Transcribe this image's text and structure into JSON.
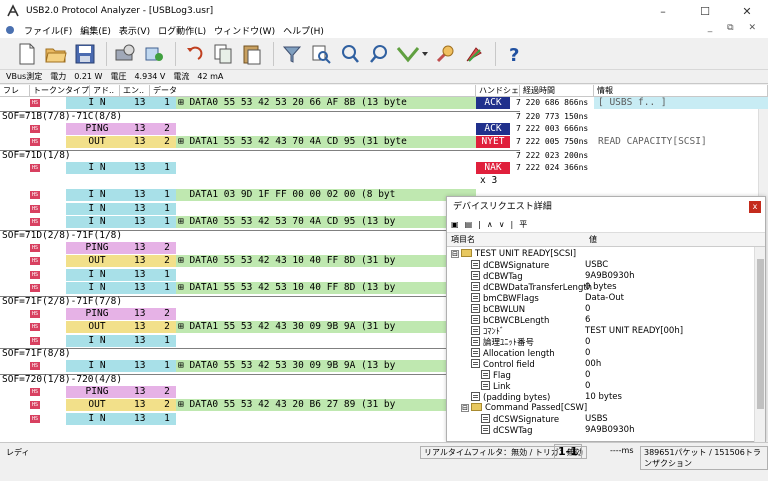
{
  "window": {
    "title": "USB2.0 Protocol Analyzer - [USBLog3.usr]",
    "minimize": "–",
    "maximize": "☐",
    "close": "✕"
  },
  "menu": {
    "items": [
      "ファイル(F)",
      "編集(E)",
      "表示(V)",
      "ログ動作(L)",
      "ウィンドウ(W)",
      "ヘルプ(H)"
    ],
    "mdi": "_ ⧉ ✕"
  },
  "vbus": {
    "label": "VBus測定",
    "power_label": "電力",
    "power": "0.21 W",
    "voltage_label": "電圧",
    "voltage": "4.934 V",
    "current_label": "電流",
    "current": "42 mA"
  },
  "columns": {
    "frame": "フレー..",
    "token": "トークンタイプ",
    "addr": "アド..",
    "ep": "エン..",
    "data": "データ",
    "handshake": "ハンドシェイ..",
    "elapsed": "経過時間",
    "info": "情報"
  },
  "trace": [
    {
      "kind": "pkt",
      "token": "I N",
      "addr": "13",
      "ep": "1",
      "expand": true,
      "data": "DATA0 55 53 42 53 20 66 AF 8B (13 byte",
      "hs": "ACK",
      "time": "7 220 686 866ns",
      "info": "[ USBS f.. ]"
    },
    {
      "kind": "sof",
      "text": "SOF=71B(7/8)-71C(8/8)",
      "time": "7 220 773 150ns"
    },
    {
      "kind": "pkt",
      "token": "PING",
      "addr": "13",
      "ep": "2",
      "expand": false,
      "data": "",
      "hs": "ACK",
      "time": "7 222 003 666ns",
      "info": ""
    },
    {
      "kind": "pkt",
      "token": "OUT",
      "addr": "13",
      "ep": "2",
      "expand": true,
      "data": "DATA1 55 53 42 43 70 4A CD 95 (31 byte",
      "hs": "NYET",
      "time": "7 222 005 750ns",
      "info": "READ CAPACITY[SCSI]"
    },
    {
      "kind": "sof",
      "text": "SOF=71D(1/8)",
      "time": "7 222 023 200ns"
    },
    {
      "kind": "pkt",
      "token": "I N",
      "addr": "13",
      "ep": "1",
      "expand": false,
      "data": "",
      "hs": "NAK",
      "time": "7 222 024 366ns",
      "info": ""
    },
    {
      "kind": "count",
      "text": "x 3"
    },
    {
      "kind": "pkt",
      "token": "I N",
      "addr": "13",
      "ep": "1",
      "expand": false,
      "data": "DATA1 03 9D 1F FF 00 00 02 00 (8 byt",
      "hs": "",
      "time": "",
      "info": ""
    },
    {
      "kind": "pkt",
      "token": "I N",
      "addr": "13",
      "ep": "1",
      "expand": false,
      "data": "",
      "hs": "",
      "time": "",
      "info": ""
    },
    {
      "kind": "pkt",
      "token": "I N",
      "addr": "13",
      "ep": "1",
      "expand": true,
      "data": "DATA0 55 53 42 53 70 4A CD 95 (13 by",
      "hs": "",
      "time": "",
      "info": ""
    },
    {
      "kind": "sof",
      "text": "SOF=71D(2/8)-71F(1/8)",
      "time": ""
    },
    {
      "kind": "pkt",
      "token": "PING",
      "addr": "13",
      "ep": "2",
      "expand": false,
      "data": "",
      "hs": "",
      "time": "",
      "info": ""
    },
    {
      "kind": "pkt",
      "token": "OUT",
      "addr": "13",
      "ep": "2",
      "expand": true,
      "data": "DATA0 55 53 42 43 10 40 FF 8D (31 by",
      "hs": "",
      "time": "",
      "info": ""
    },
    {
      "kind": "pkt",
      "token": "I N",
      "addr": "13",
      "ep": "1",
      "expand": false,
      "data": "",
      "hs": "",
      "time": "",
      "info": ""
    },
    {
      "kind": "pkt",
      "token": "I N",
      "addr": "13",
      "ep": "1",
      "expand": true,
      "data": "DATA1 55 53 42 53 10 40 FF 8D (13 by",
      "hs": "",
      "time": "",
      "info": ""
    },
    {
      "kind": "sof",
      "text": "SOF=71F(2/8)-71F(7/8)",
      "time": ""
    },
    {
      "kind": "pkt",
      "token": "PING",
      "addr": "13",
      "ep": "2",
      "expand": false,
      "data": "",
      "hs": "",
      "time": "",
      "info": ""
    },
    {
      "kind": "pkt",
      "token": "OUT",
      "addr": "13",
      "ep": "2",
      "expand": true,
      "data": "DATA1 55 53 42 43 30 09 9B 9A (31 by",
      "hs": "",
      "time": "",
      "info": ""
    },
    {
      "kind": "pkt",
      "token": "I N",
      "addr": "13",
      "ep": "1",
      "expand": false,
      "data": "",
      "hs": "",
      "time": "",
      "info": ""
    },
    {
      "kind": "sof",
      "text": "SOF=71F(8/8)",
      "time": ""
    },
    {
      "kind": "pkt",
      "token": "I N",
      "addr": "13",
      "ep": "1",
      "expand": true,
      "data": "DATA0 55 53 42 53 30 09 9B 9A (13 by",
      "hs": "",
      "time": "",
      "info": ""
    },
    {
      "kind": "sof",
      "text": "SOF=720(1/8)-720(4/8)",
      "time": ""
    },
    {
      "kind": "pkt",
      "token": "PING",
      "addr": "13",
      "ep": "2",
      "expand": false,
      "data": "",
      "hs": "",
      "time": "",
      "info": ""
    },
    {
      "kind": "pkt",
      "token": "OUT",
      "addr": "13",
      "ep": "2",
      "expand": true,
      "data": "DATA0 55 53 42 43 20 B6 27 89 (31 by",
      "hs": "",
      "time": "",
      "info": ""
    },
    {
      "kind": "pkt",
      "token": "I N",
      "addr": "13",
      "ep": "1",
      "expand": false,
      "data": "",
      "hs": "",
      "time": "",
      "info": ""
    }
  ],
  "panel": {
    "title": "デバイスリクエスト詳細",
    "close": "x",
    "toolbar": [
      "▣",
      "▤",
      "|",
      "∧",
      "∨",
      "|",
      "平"
    ],
    "col_name": "項目名",
    "col_value": "値",
    "rows": [
      {
        "level": 0,
        "type": "folder",
        "exp": "⊟",
        "name": "TEST UNIT READY[SCSI]",
        "value": ""
      },
      {
        "level": 2,
        "type": "item",
        "name": "dCBWSignature",
        "value": "USBC"
      },
      {
        "level": 2,
        "type": "item",
        "name": "dCBWTag",
        "value": "9A9B0930h"
      },
      {
        "level": 2,
        "type": "item",
        "name": "dCBWDataTransferLength",
        "value": "0 bytes"
      },
      {
        "level": 2,
        "type": "item",
        "name": "bmCBWFlags",
        "value": "Data-Out"
      },
      {
        "level": 2,
        "type": "item",
        "name": "bCBWLUN",
        "value": "0"
      },
      {
        "level": 2,
        "type": "item",
        "name": "bCBWCBLength",
        "value": "6"
      },
      {
        "level": 2,
        "type": "item",
        "name": "ｺﾏﾝﾄﾞ",
        "value": "TEST UNIT READY[00h]"
      },
      {
        "level": 2,
        "type": "item",
        "name": "論理ﾕﾆｯﾄ番号",
        "value": "0"
      },
      {
        "level": 2,
        "type": "item",
        "name": "Allocation length",
        "value": "0"
      },
      {
        "level": 2,
        "type": "item",
        "name": "Control field",
        "value": "00h"
      },
      {
        "level": 3,
        "type": "item",
        "name": "Flag",
        "value": "0"
      },
      {
        "level": 3,
        "type": "item",
        "name": "Link",
        "value": "0"
      },
      {
        "level": 2,
        "type": "item",
        "name": "(padding bytes)",
        "value": "10 bytes"
      },
      {
        "level": 1,
        "type": "folder",
        "exp": "⊟",
        "name": "Command Passed[CSW]",
        "value": ""
      },
      {
        "level": 3,
        "type": "item",
        "name": "dCSWSignature",
        "value": "USBS"
      },
      {
        "level": 3,
        "type": "item",
        "name": "dCSWTag",
        "value": "9A9B0930h"
      }
    ]
  },
  "status": {
    "ready": "レディ",
    "filter": "リアルタイムフィルタ：無効 / トリガ：無効",
    "range": "1-1",
    "unit": "----ms",
    "count": "389651パケット / 151506トランザクション"
  },
  "colors": {
    "ack": "#20308c",
    "nak": "#e0203c",
    "in": "#a8e0e8",
    "out": "#f2e08a",
    "ping": "#e6b2e6",
    "data": "#bfe8b0"
  },
  "icons": [
    "app-logo-icon",
    "wrench-icon",
    "new-icon",
    "open-icon",
    "save-icon",
    "settings-icon",
    "device-icon",
    "undo-icon",
    "copy-icon",
    "paste-icon",
    "filter-icon",
    "find-icon",
    "find-next-icon",
    "find-prev-icon",
    "trigger-icon",
    "search-icon",
    "help-icon"
  ]
}
